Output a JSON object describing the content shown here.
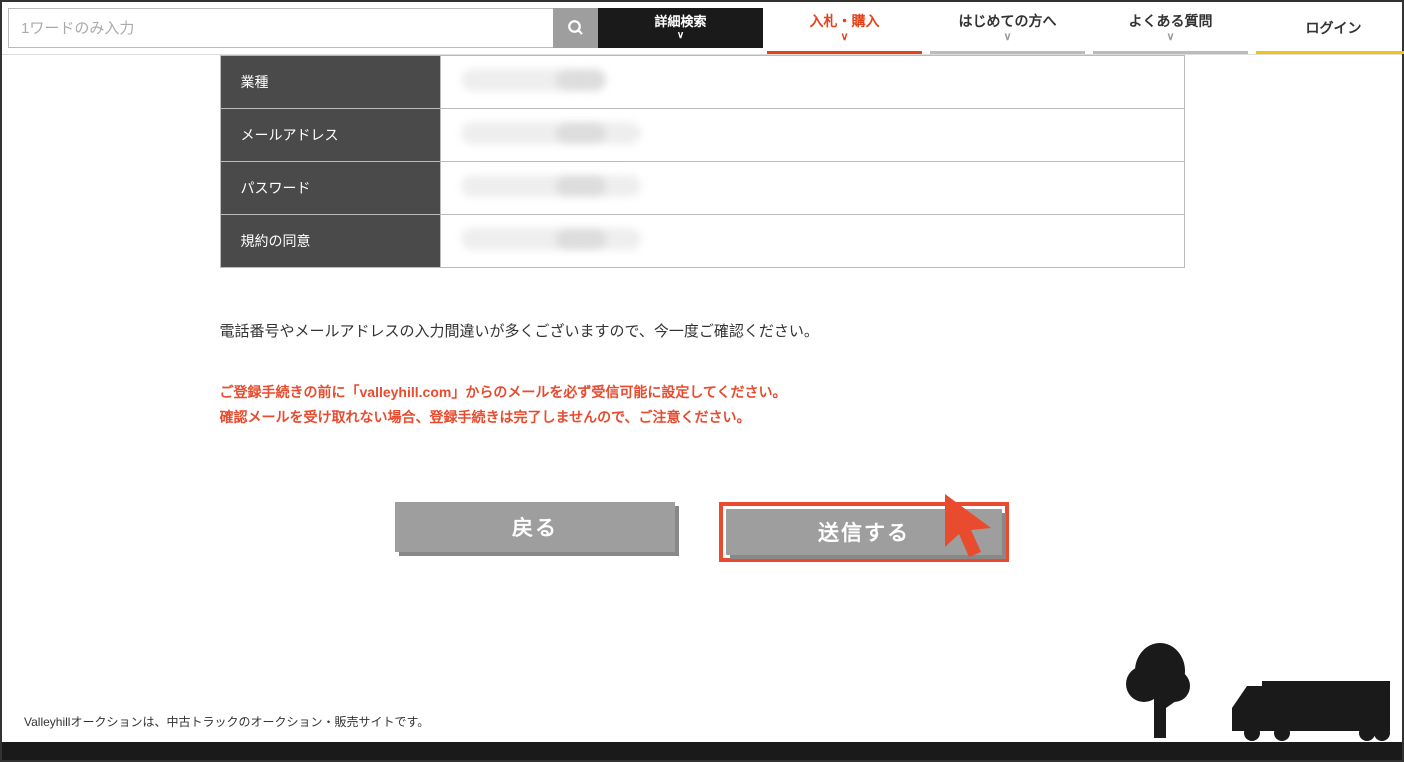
{
  "search": {
    "placeholder": "1ワードのみ入力",
    "adv_label": "詳細検索"
  },
  "nav": {
    "items": [
      {
        "label": "入札・購入"
      },
      {
        "label": "はじめての方へ"
      },
      {
        "label": "よくある質問"
      },
      {
        "label": "ログイン"
      }
    ]
  },
  "form": {
    "rows": [
      {
        "label": "業種"
      },
      {
        "label": "メールアドレス"
      },
      {
        "label": "パスワード"
      },
      {
        "label": "規約の同意"
      }
    ]
  },
  "notice": "電話番号やメールアドレスの入力間違いが多くございますので、今一度ご確認ください。",
  "warn_line1": "ご登録手続きの前に「valleyhill.com」からのメールを必ず受信可能に設定してください。",
  "warn_line2": "確認メールを受け取れない場合、登録手続きは完了しませんので、ご注意ください。",
  "buttons": {
    "back": "戻る",
    "submit": "送信する"
  },
  "footer": "Valleyhillオークションは、中古トラックのオークション・販売サイトです。",
  "chevron": "∨"
}
